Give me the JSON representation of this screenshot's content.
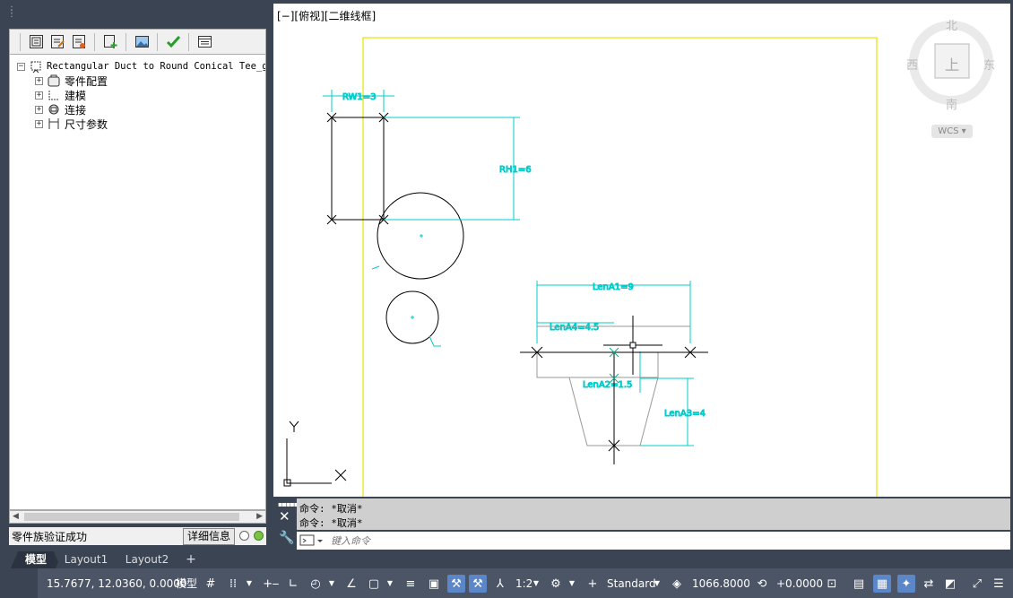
{
  "palette": {
    "toolbar": {
      "buttons": [
        "param-list-icon",
        "edit-param-icon",
        "export-icon",
        "add-icon",
        "image-icon",
        "validate-check-icon",
        "properties-icon"
      ]
    },
    "tree": {
      "root": "Rectangular Duct to Round Conical Tee_gb",
      "nodes": [
        "零件配置",
        "建模",
        "连接",
        "尺寸参数"
      ]
    },
    "status": {
      "message": "零件族验证成功",
      "details_label": "详细信息"
    }
  },
  "viewport": {
    "view_label": "[−][俯视][二维线框]",
    "viewcube": {
      "north": "北",
      "south": "南",
      "east": "东",
      "west": "西",
      "top": "上",
      "wcs": "WCS"
    },
    "dimensions": {
      "rw1": "RW1=3",
      "rh1": "RH1=6",
      "lena1": "LenA1=9",
      "lena4": "LenA4=4.5",
      "lena2": "LenA2=1.5",
      "lena3": "LenA3=4"
    },
    "ucs": {
      "x": "X",
      "y": "Y"
    }
  },
  "command": {
    "history": [
      "命令: *取消*",
      "命令: *取消*"
    ],
    "placeholder": "键入命令"
  },
  "layout_tabs": [
    "模型",
    "Layout1",
    "Layout2",
    "+"
  ],
  "statusbar": {
    "coordinates": "15.7677, 12.0360, 0.0000",
    "space": "模型",
    "annotation_scale": "1:2",
    "style": "Standard",
    "elevation": "1066.8000",
    "offset": "+0.0000"
  }
}
